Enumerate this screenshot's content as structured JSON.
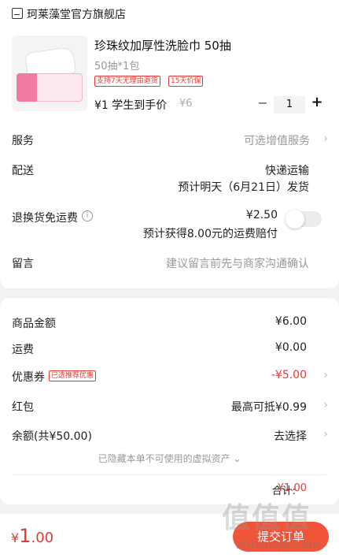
{
  "store": {
    "name": "珂莱藻堂官方旗舰店",
    "icon": "store-icon"
  },
  "product": {
    "title": "珍珠纹加厚性洗脸巾 50抽",
    "spec": "50抽*1包",
    "tags": [
      "支持7天无理由退货",
      "15天价保"
    ],
    "price_label": "¥1 学生到手价",
    "original_price": "¥6",
    "quantity": "1",
    "qty_minus": "−",
    "qty_plus": "+"
  },
  "rows": {
    "service": {
      "label": "服务",
      "value": "可选增值服务"
    },
    "delivery": {
      "label": "配送",
      "method": "快递运输",
      "eta": "预计明天（6月21日）发货"
    },
    "return_insurance": {
      "label": "退换货免运费",
      "price": "¥2.50",
      "note": "预计获得8.00元的运费赔付",
      "info_icon": "i"
    },
    "message": {
      "label": "留言",
      "placeholder": "建议留言前先与商家沟通确认"
    }
  },
  "summary": {
    "goods_amount": {
      "label": "商品金额",
      "value": "¥6.00"
    },
    "shipping": {
      "label": "运费",
      "value": "¥0.00"
    },
    "coupon": {
      "label": "优惠券",
      "badge": "已选推荐优惠",
      "value": "-¥5.00"
    },
    "red_packet": {
      "label": "红包",
      "value": "最高可抵¥0.99"
    },
    "balance": {
      "label": "余额(共¥50.00)",
      "value": "去选择"
    },
    "hidden_note": "已隐藏本单不可使用的虚拟资产 ⌄",
    "total_label": "合计:",
    "total_value": "¥1.00"
  },
  "bottom": {
    "currency": "¥",
    "amount_int": "1",
    "amount_dec": ".00",
    "submit_label": "提交订单"
  },
  "watermark": {
    "text": "值值值",
    "url": "zhizhizhi.com"
  },
  "colors": {
    "accent_red": "#e53935",
    "submit_bg": "#f0553a",
    "page_bg": "#f2f2f2"
  }
}
